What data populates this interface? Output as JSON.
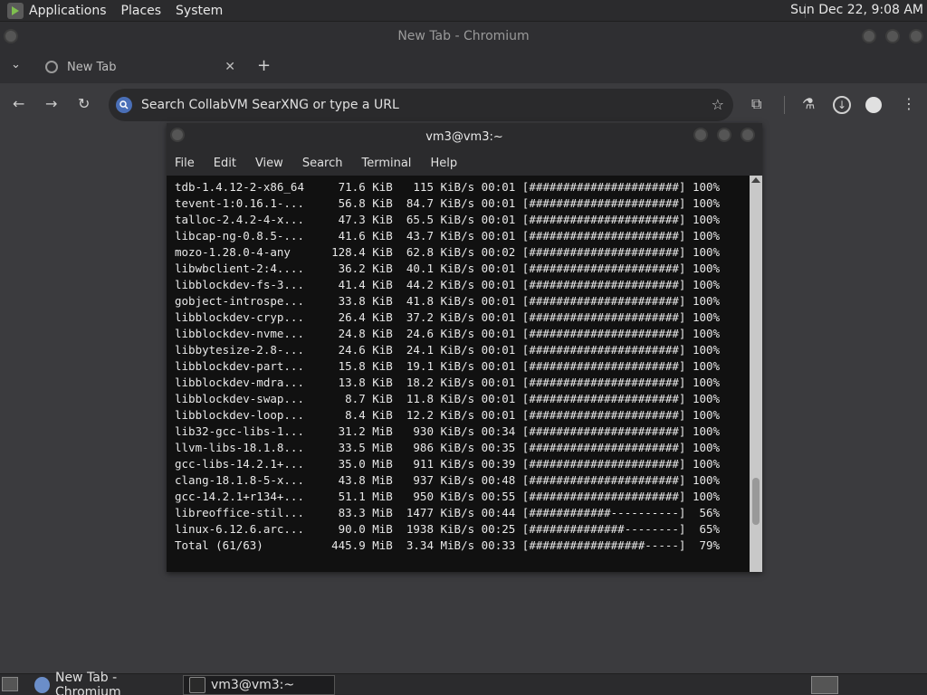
{
  "top_panel": {
    "applications": "Applications",
    "places": "Places",
    "system": "System",
    "clock": "Sun Dec 22,  9:08 AM"
  },
  "chromium": {
    "window_title": "New Tab - Chromium",
    "tab_label": "New Tab",
    "tab_close": "✕",
    "new_tab": "+",
    "omnibox_placeholder": "Search CollabVM SearXNG or type a URL",
    "icons": [
      "back-icon",
      "forward-icon",
      "reload-icon",
      "star-icon",
      "extensions-icon",
      "labs-icon",
      "download-icon",
      "profile-icon",
      "menu-icon"
    ]
  },
  "terminal": {
    "title": "vm3@vm3:~",
    "menu": [
      "File",
      "Edit",
      "View",
      "Search",
      "Terminal",
      "Help"
    ],
    "lines": [
      "tdb-1.4.12-2-x86_64     71.6 KiB   115 KiB/s 00:01 [######################] 100%",
      "tevent-1:0.16.1-...     56.8 KiB  84.7 KiB/s 00:01 [######################] 100%",
      "talloc-2.4.2-4-x...     47.3 KiB  65.5 KiB/s 00:01 [######################] 100%",
      "libcap-ng-0.8.5-...     41.6 KiB  43.7 KiB/s 00:01 [######################] 100%",
      "mozo-1.28.0-4-any      128.4 KiB  62.8 KiB/s 00:02 [######################] 100%",
      "libwbclient-2:4....     36.2 KiB  40.1 KiB/s 00:01 [######################] 100%",
      "libblockdev-fs-3...     41.4 KiB  44.2 KiB/s 00:01 [######################] 100%",
      "gobject-introspe...     33.8 KiB  41.8 KiB/s 00:01 [######################] 100%",
      "libblockdev-cryp...     26.4 KiB  37.2 KiB/s 00:01 [######################] 100%",
      "libblockdev-nvme...     24.8 KiB  24.6 KiB/s 00:01 [######################] 100%",
      "libbytesize-2.8-...     24.6 KiB  24.1 KiB/s 00:01 [######################] 100%",
      "libblockdev-part...     15.8 KiB  19.1 KiB/s 00:01 [######################] 100%",
      "libblockdev-mdra...     13.8 KiB  18.2 KiB/s 00:01 [######################] 100%",
      "libblockdev-swap...      8.7 KiB  11.8 KiB/s 00:01 [######################] 100%",
      "libblockdev-loop...      8.4 KiB  12.2 KiB/s 00:01 [######################] 100%",
      "lib32-gcc-libs-1...     31.2 MiB   930 KiB/s 00:34 [######################] 100%",
      "llvm-libs-18.1.8...     33.5 MiB   986 KiB/s 00:35 [######################] 100%",
      "gcc-libs-14.2.1+...     35.0 MiB   911 KiB/s 00:39 [######################] 100%",
      "clang-18.1.8-5-x...     43.8 MiB   937 KiB/s 00:48 [######################] 100%",
      "gcc-14.2.1+r134+...     51.1 MiB   950 KiB/s 00:55 [######################] 100%",
      "libreoffice-stil...     83.3 MiB  1477 KiB/s 00:44 [############----------]  56%",
      "linux-6.12.6.arc...     90.0 MiB  1938 KiB/s 00:25 [##############--------]  65%",
      "Total (61/63)          445.9 MiB  3.34 MiB/s 00:33 [#################-----]  79%"
    ]
  },
  "taskbar": {
    "items": [
      {
        "label": "New Tab - Chromium"
      },
      {
        "label": "vm3@vm3:~"
      }
    ]
  }
}
